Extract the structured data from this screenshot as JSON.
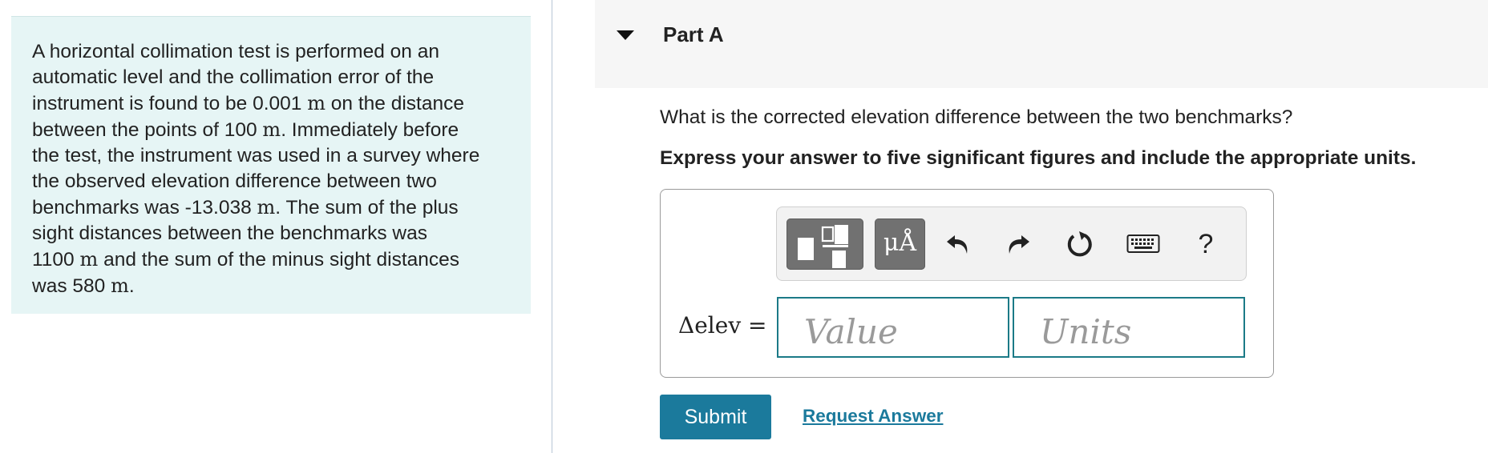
{
  "problem": {
    "lines": [
      [
        {
          "t": "A horizontal collimation test is performed on an"
        }
      ],
      [
        {
          "t": "automatic level and the collimation error of the"
        }
      ],
      [
        {
          "t": "instrument is found to be 0.001 "
        },
        {
          "t": "m",
          "math": true
        },
        {
          "t": " on the distance"
        }
      ],
      [
        {
          "t": "between the points of 100 "
        },
        {
          "t": "m",
          "math": true
        },
        {
          "t": ". Immediately before"
        }
      ],
      [
        {
          "t": "the test, the instrument was used in a survey where"
        }
      ],
      [
        {
          "t": "the observed elevation difference between two"
        }
      ],
      [
        {
          "t": "benchmarks was -13.038 "
        },
        {
          "t": "m",
          "math": true
        },
        {
          "t": ". The sum of the plus"
        }
      ],
      [
        {
          "t": "sight distances between the benchmarks was"
        }
      ],
      [
        {
          "t": "1100 "
        },
        {
          "t": "m",
          "math": true
        },
        {
          "t": " and the sum of the minus sight distances"
        }
      ],
      [
        {
          "t": "was 580 "
        },
        {
          "t": "m",
          "math": true
        },
        {
          "t": "."
        }
      ]
    ]
  },
  "part": {
    "title": "Part A"
  },
  "question": "What is the corrected elevation difference between the two benchmarks?",
  "instruction": "Express your answer to five significant figures and include the appropriate units.",
  "toolbar": {
    "units_label": "μÅ",
    "help_label": "?",
    "icons": [
      "templates-icon",
      "units-icon",
      "undo-icon",
      "redo-icon",
      "reset-icon",
      "keyboard-icon",
      "help-icon"
    ]
  },
  "answer": {
    "lhs": "Δelev =",
    "value_placeholder": "Value",
    "units_placeholder": "Units"
  },
  "actions": {
    "submit": "Submit",
    "request": "Request Answer"
  },
  "colors": {
    "accent": "#1b7a9c",
    "field_border": "#1b7a87",
    "problem_bg": "#e6f5f5"
  }
}
